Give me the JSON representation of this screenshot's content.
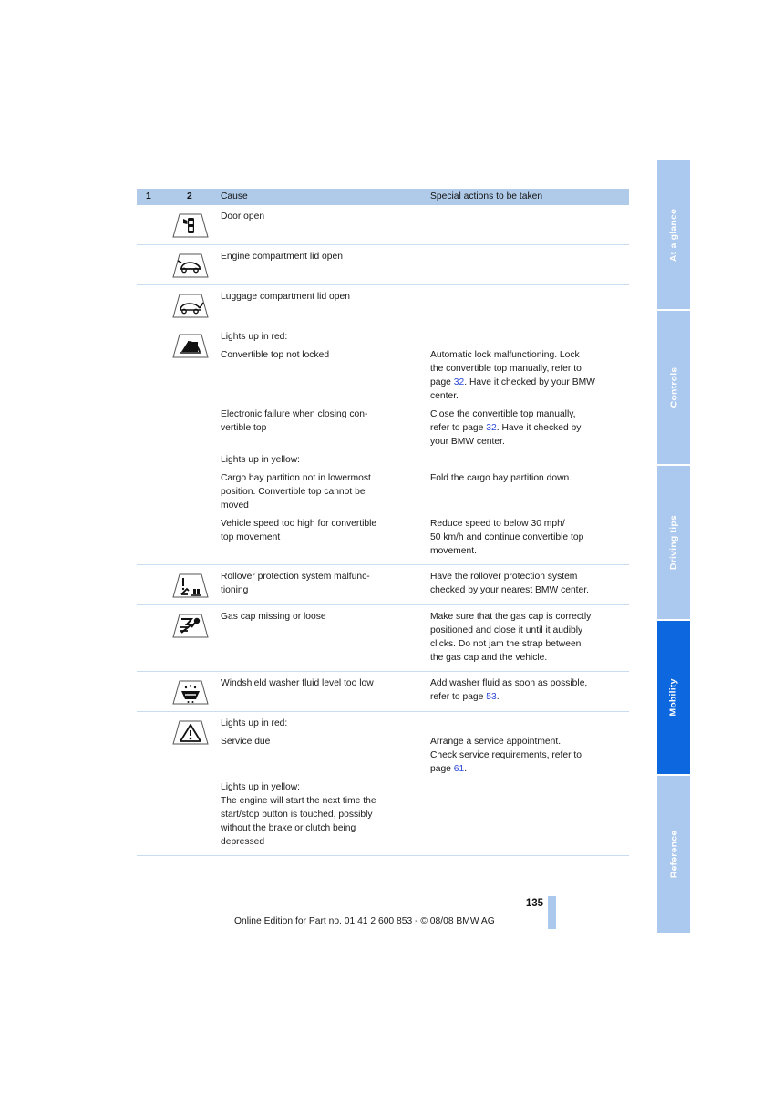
{
  "document": {
    "page_number": "135",
    "footer_note": "Online Edition for Part no. 01 41 2 600 853 - © 08/08 BMW AG"
  },
  "tabs": [
    {
      "label": "At a glance",
      "active": false
    },
    {
      "label": "Controls",
      "active": false
    },
    {
      "label": "Driving tips",
      "active": false
    },
    {
      "label": "Mobility",
      "active": true
    },
    {
      "label": "Reference",
      "active": false
    }
  ],
  "table": {
    "headers": {
      "col1": "1",
      "col2": "2",
      "cause": "Cause",
      "actions": "Special actions to be taken"
    },
    "rows": [
      {
        "icon": "door-open-indicator-icon",
        "cause_blocks": [
          {
            "lines": [
              "Door open"
            ]
          }
        ],
        "action_blocks": []
      },
      {
        "icon": "engine-compartment-lid-open-indicator-icon",
        "cause_blocks": [
          {
            "lines": [
              "Engine compartment lid open"
            ]
          }
        ],
        "action_blocks": []
      },
      {
        "icon": "luggage-compartment-lid-open-indicator-icon",
        "cause_blocks": [
          {
            "lines": [
              "Luggage compartment lid open"
            ]
          }
        ],
        "action_blocks": []
      },
      {
        "icon": "convertible-top-indicator-icon",
        "cause_blocks": [
          {
            "lines": [
              "Lights up in red:"
            ]
          },
          {
            "lines": [
              "Convertible top not locked"
            ]
          },
          {
            "lines": [
              "Electronic failure when closing con-",
              "vertible top"
            ]
          },
          {
            "lines": [
              "Lights up in yellow:"
            ]
          },
          {
            "lines": [
              "Cargo bay partition not in lowermost",
              "position. Convertible top cannot be",
              "moved"
            ]
          },
          {
            "lines": [
              "Vehicle speed too high for convertible",
              "top movement"
            ]
          }
        ],
        "action_blocks": [
          {
            "lines": []
          },
          {
            "lines": [
              "Automatic lock malfunctioning. Lock",
              "the convertible top manually, refer to",
              "page 32. Have it checked by your BMW",
              "center."
            ],
            "ref": "32"
          },
          {
            "lines": [
              "Close the convertible top manually,",
              "refer to page 32. Have it checked by",
              "your BMW center."
            ],
            "ref": "32"
          },
          {
            "lines": []
          },
          {
            "lines": [
              "Fold the cargo bay partition down."
            ]
          },
          {
            "lines": [
              "Reduce speed to below 30 mph/",
              "50 km/h and continue convertible top",
              "movement."
            ]
          }
        ]
      },
      {
        "icon": "rollover-protection-indicator-icon",
        "cause_blocks": [
          {
            "lines": [
              "Rollover protection system malfunc-",
              "tioning"
            ]
          }
        ],
        "action_blocks": [
          {
            "lines": [
              "Have the rollover protection system",
              "checked by your nearest BMW center."
            ]
          }
        ]
      },
      {
        "icon": "gas-cap-indicator-icon",
        "cause_blocks": [
          {
            "lines": [
              "Gas cap missing or loose"
            ]
          }
        ],
        "action_blocks": [
          {
            "lines": [
              "Make sure that the gas cap is correctly",
              "positioned and close it until it audibly",
              "clicks. Do not jam the strap between",
              "the gas cap and the vehicle."
            ]
          }
        ]
      },
      {
        "icon": "washer-fluid-indicator-icon",
        "cause_blocks": [
          {
            "lines": [
              "Windshield washer fluid level too low"
            ]
          }
        ],
        "action_blocks": [
          {
            "lines": [
              "Add washer fluid as soon as possible,",
              "refer to page 53."
            ],
            "ref": "53"
          }
        ]
      },
      {
        "icon": "service-due-warning-icon",
        "cause_blocks": [
          {
            "lines": [
              "Lights up in red:"
            ]
          },
          {
            "lines": [
              "Service due"
            ]
          },
          {
            "lines": [
              "Lights up in yellow:",
              "The engine will start the next time the",
              "start/stop button is touched, possibly",
              "without the brake or clutch being",
              "depressed"
            ]
          }
        ],
        "action_blocks": [
          {
            "lines": []
          },
          {
            "lines": [
              "Arrange a service appointment.",
              "Check service requirements, refer to",
              "page 61."
            ],
            "ref": "61"
          },
          {
            "lines": []
          }
        ]
      }
    ]
  },
  "colors": {
    "header_blue": "#b0cbe9",
    "tab_blue": "#abc8ee",
    "tab_active_blue": "#0d68e0",
    "page_ref_blue": "#2c48d8",
    "row_rule": "#c9dcf0"
  }
}
